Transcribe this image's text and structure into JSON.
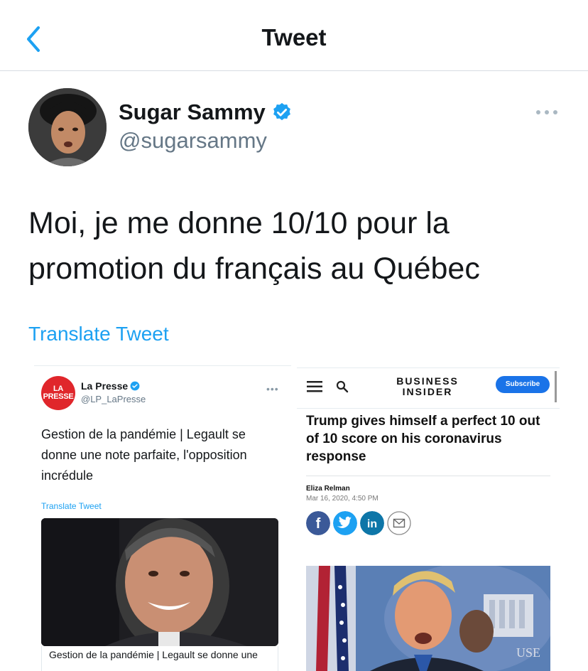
{
  "header": {
    "title": "Tweet"
  },
  "tweet": {
    "display_name": "Sugar Sammy",
    "handle": "@sugarsammy",
    "text": "Moi, je me donne 10/10 pour la promotion du français au Québec",
    "translate_label": "Translate Tweet"
  },
  "embed_left": {
    "logo_line1": "LA",
    "logo_line2": "PRESSE",
    "name": "La Presse",
    "handle": "@LP_LaPresse",
    "more": "•••",
    "text": "Gestion de la pandémie | Legault se donne une note parfaite, l'opposition incrédule",
    "translate_label": "Translate Tweet",
    "caption": "Gestion de la pandémie | Legault se donne une"
  },
  "embed_right": {
    "logo_line1": "BUSINESS",
    "logo_line2": "INSIDER",
    "subscribe_label": "Subscribe",
    "headline": "Trump gives himself a perfect 10 out of 10 score on his coronavirus response",
    "author": "Eliza Relman",
    "date": "Mar 16, 2020, 4:50 PM",
    "share": {
      "facebook": "f",
      "linkedin": "in"
    },
    "sign_text": "USE"
  },
  "colors": {
    "twitter_blue": "#1da1f2",
    "la_presse_red": "#e0262b",
    "bi_subscribe_blue": "#1a73e8",
    "facebook": "#3b5998",
    "twitter_share": "#1da1f2",
    "linkedin": "#0e76a8"
  },
  "icons": {
    "back": "chevron-left-icon",
    "verified": "verified-badge-icon",
    "more": "more-horizontal-icon",
    "menu": "hamburger-menu-icon",
    "search": "search-icon",
    "mail": "mail-icon"
  }
}
